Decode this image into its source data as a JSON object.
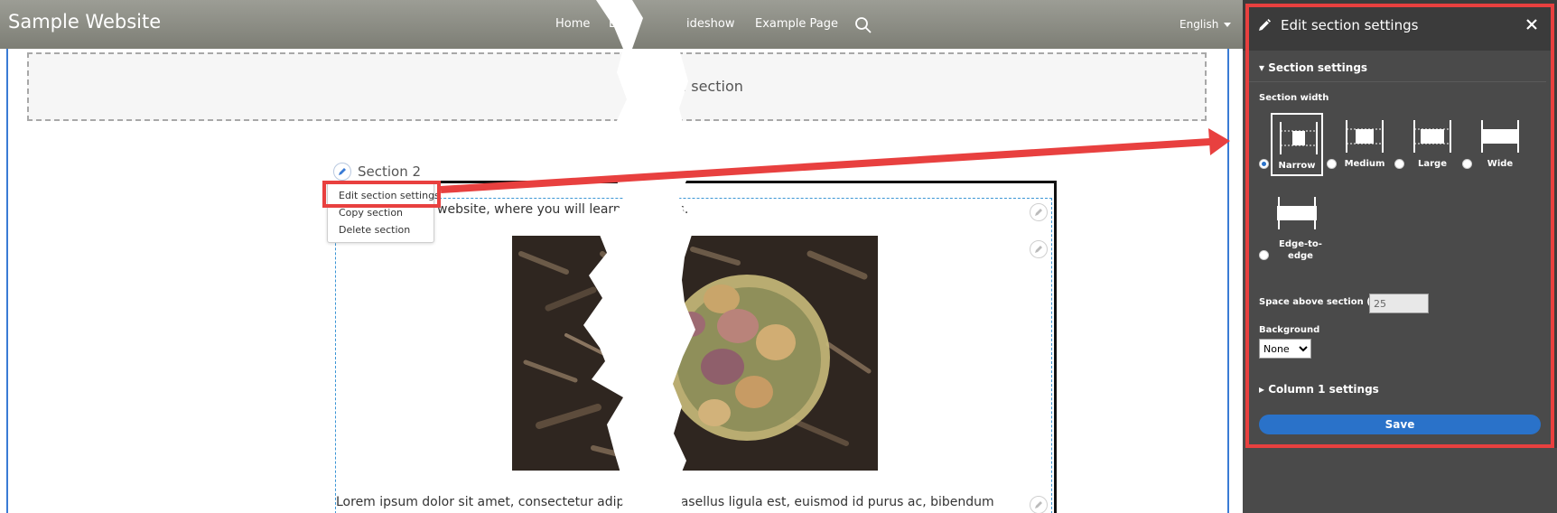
{
  "site": {
    "title": "Sample Website",
    "nav": [
      "Home",
      "Bl",
      "ideshow",
      "Example Page"
    ],
    "language": "English"
  },
  "content": {
    "add_section_label": "d section",
    "section_title": "Section 2",
    "context_menu": [
      "Edit section settings",
      "Copy section",
      "Delete section"
    ],
    "intro_text": "website, where you will learn a        otatoes.",
    "body_text": "Lorem ipsum dolor sit amet, consectetur adipiscing          Phasellus ligula est, euismod id purus ac, bibendum"
  },
  "panel": {
    "title": "Edit section settings",
    "section_settings_header": "Section settings",
    "section_width_label": "Section width",
    "width_options": [
      {
        "label": "Narrow",
        "selected": true
      },
      {
        "label": "Medium",
        "selected": false
      },
      {
        "label": "Large",
        "selected": false
      },
      {
        "label": "Wide",
        "selected": false
      },
      {
        "label": "Edge-to-edge",
        "selected": false
      }
    ],
    "space_above_label": "Space above section (px)",
    "space_above_value": "25",
    "background_label": "Background",
    "background_value": "None",
    "column_settings_header": "Column 1 settings",
    "save_label": "Save"
  },
  "colors": {
    "navbar": "#8c8d84",
    "panel": "#4a4a4a",
    "annotation": "#e8403f",
    "accent": "#2a72c9"
  }
}
